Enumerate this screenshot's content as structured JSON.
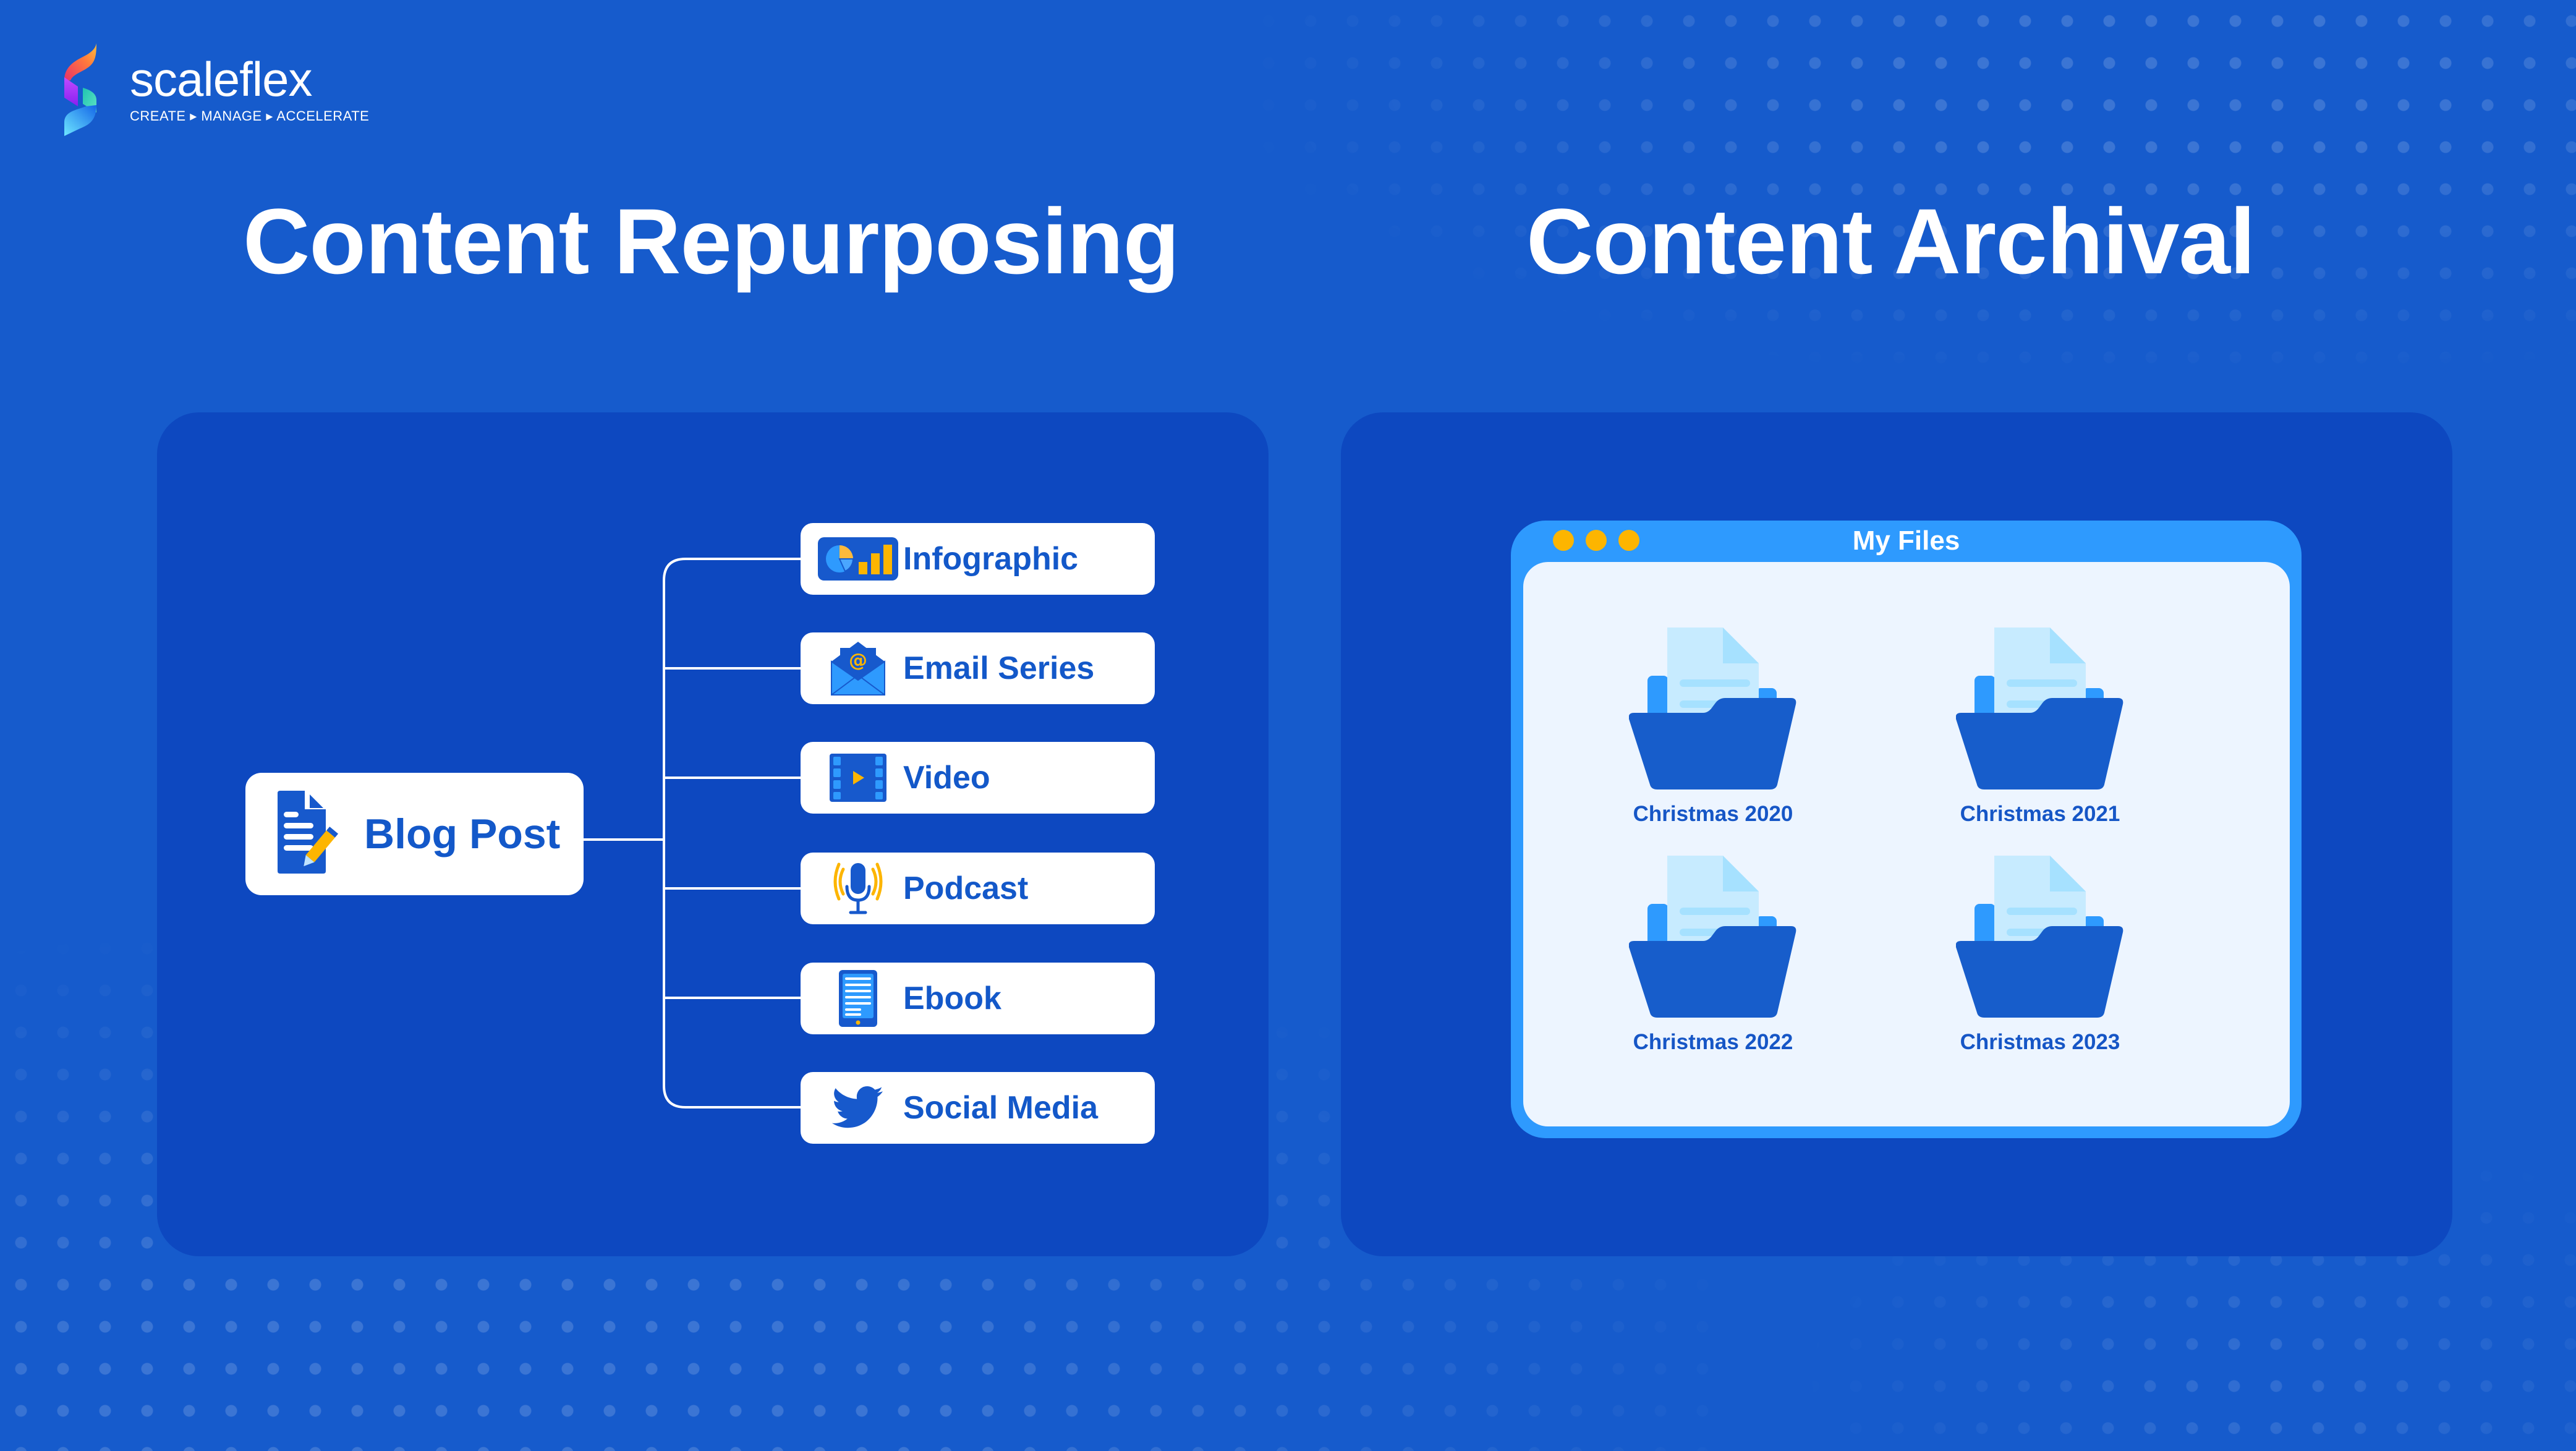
{
  "brand": {
    "name": "scaleflex",
    "tagline": "CREATE ▸ MANAGE ▸ ACCELERATE"
  },
  "colors": {
    "background": "#165BCC",
    "panel": "#0D48C0",
    "card": "#FFFFFF",
    "accent_text": "#1358C9",
    "window_frame": "#2E9AFE",
    "window_body": "#EDF5FF",
    "window_dot": "#FDB500",
    "folder": "#175DCB"
  },
  "repurposing": {
    "title": "Content Repurposing",
    "source": {
      "label": "Blog Post",
      "icon": "document-pencil-icon"
    },
    "outputs": [
      {
        "label": "Infographic",
        "icon": "infographic-chart-icon"
      },
      {
        "label": "Email Series",
        "icon": "email-envelope-icon"
      },
      {
        "label": "Video",
        "icon": "video-film-icon"
      },
      {
        "label": "Podcast",
        "icon": "microphone-icon"
      },
      {
        "label": "Ebook",
        "icon": "ebook-tablet-icon"
      },
      {
        "label": "Social Media",
        "icon": "twitter-bird-icon"
      }
    ]
  },
  "archival": {
    "title": "Content Archival",
    "window": {
      "title": "My Files",
      "folders": [
        {
          "label": "Christmas 2020"
        },
        {
          "label": "Christmas 2021"
        },
        {
          "label": "Christmas 2022"
        },
        {
          "label": "Christmas 2023"
        }
      ]
    }
  }
}
